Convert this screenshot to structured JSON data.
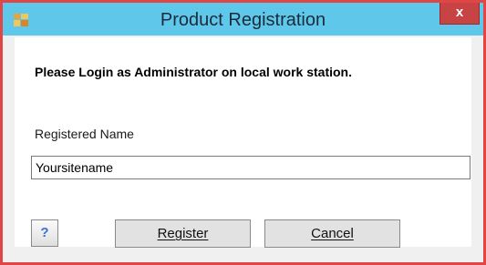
{
  "window": {
    "title": "Product Registration",
    "close_label": "x",
    "app_icon": "app-window-icon"
  },
  "dialog": {
    "heading": "Please Login as Administrator on local work station.",
    "name_label": "Registered Name",
    "name_value": "Yoursitename",
    "help_label": "?",
    "register_label": "Register",
    "cancel_label": "Cancel"
  },
  "colors": {
    "titlebar": "#5fc8ea",
    "border": "#e04646",
    "close": "#c84444",
    "help_glyph": "#3a6fd6"
  }
}
